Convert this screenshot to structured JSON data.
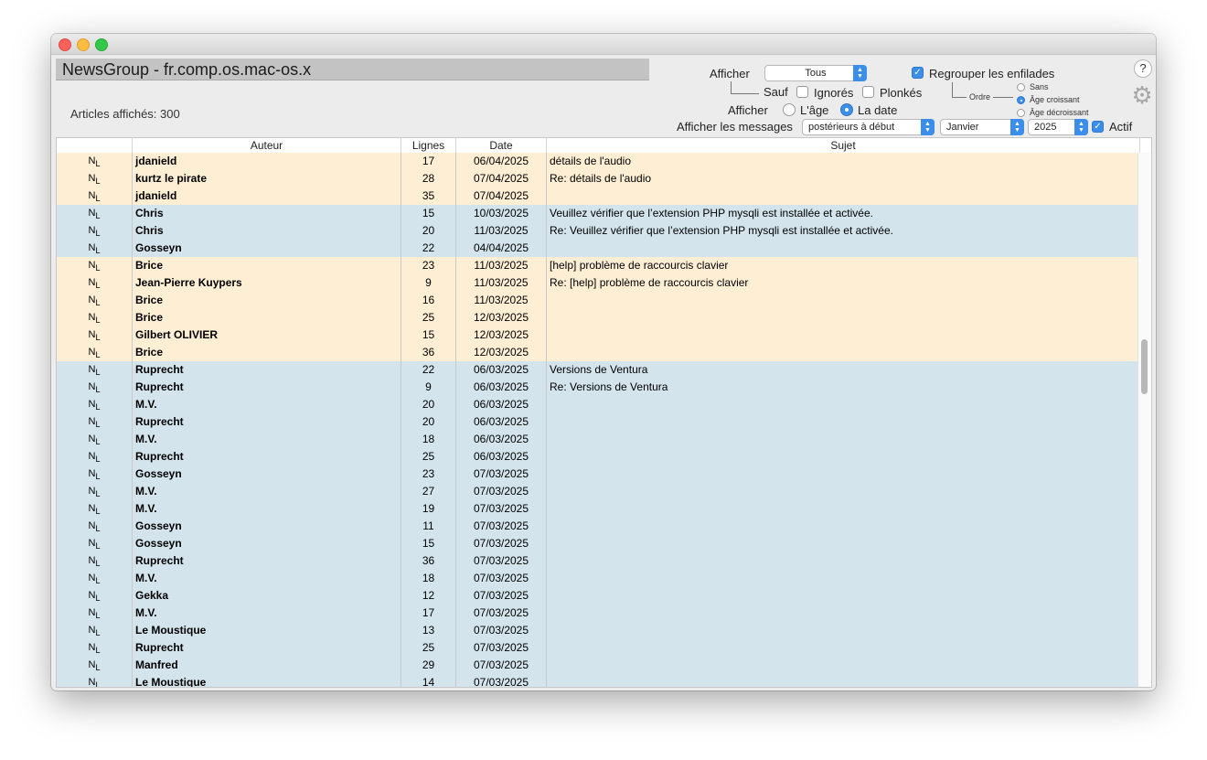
{
  "window": {
    "title": "NewsGroup - fr.comp.os.mac-os.x"
  },
  "status": {
    "articles_count": "Articles affichés: 300"
  },
  "filters": {
    "afficher_label": "Afficher",
    "show_select": "Tous",
    "sauf_label": "Sauf",
    "ignores_label": "Ignorés",
    "ignores_checked": false,
    "plonkes_label": "Plonkés",
    "plonkes_checked": false,
    "group_threads_label": "Regrouper les enfilades",
    "group_threads_checked": true,
    "ordre_label": "Ordre",
    "order_options": [
      "Sans",
      "Âge croissant",
      "Âge décroissant"
    ],
    "order_selected": "Âge croissant",
    "afficher2_label": "Afficher",
    "sort_age_label": "L'âge",
    "sort_date_label": "La date",
    "sort_selected": "La date",
    "show_messages_label": "Afficher les messages",
    "messages_select": "postérieurs à début",
    "month_select": "Janvier",
    "year_select": "2025",
    "actif_label": "Actif",
    "actif_checked": true
  },
  "icons": {
    "help": "?",
    "gear": "⚙",
    "row_marker": "N",
    "row_marker_sub": "L"
  },
  "table": {
    "columns": [
      "Auteur",
      "Lignes",
      "Date",
      "Sujet"
    ],
    "rows": [
      {
        "author": "jdanield",
        "lines": "17",
        "date": "06/04/2025",
        "subject": "détails de l'audio",
        "group": "orange"
      },
      {
        "author": "kurtz le pirate",
        "lines": "28",
        "date": "07/04/2025",
        "subject": "Re: détails de l'audio",
        "group": "orange"
      },
      {
        "author": "jdanield",
        "lines": "35",
        "date": "07/04/2025",
        "subject": "",
        "group": "orange"
      },
      {
        "author": "Chris",
        "lines": "15",
        "date": "10/03/2025",
        "subject": "Veuillez vérifier que l’extension PHP mysqli est installée et activée.",
        "group": "blue"
      },
      {
        "author": "Chris",
        "lines": "20",
        "date": "11/03/2025",
        "subject": "Re: Veuillez vérifier que l’extension PHP mysqli est installée et activée.",
        "group": "blue"
      },
      {
        "author": "Gosseyn",
        "lines": "22",
        "date": "04/04/2025",
        "subject": "",
        "group": "blue"
      },
      {
        "author": "Brice",
        "lines": "23",
        "date": "11/03/2025",
        "subject": "[help] problème de raccourcis clavier",
        "group": "orange"
      },
      {
        "author": "Jean-Pierre Kuypers",
        "lines": "9",
        "date": "11/03/2025",
        "subject": "Re: [help] problème de raccourcis clavier",
        "group": "orange"
      },
      {
        "author": "Brice",
        "lines": "16",
        "date": "11/03/2025",
        "subject": "",
        "group": "orange"
      },
      {
        "author": "Brice",
        "lines": "25",
        "date": "12/03/2025",
        "subject": "",
        "group": "orange"
      },
      {
        "author": "Gilbert OLIVIER",
        "lines": "15",
        "date": "12/03/2025",
        "subject": "",
        "group": "orange"
      },
      {
        "author": "Brice",
        "lines": "36",
        "date": "12/03/2025",
        "subject": "",
        "group": "orange"
      },
      {
        "author": "Ruprecht",
        "lines": "22",
        "date": "06/03/2025",
        "subject": "Versions de Ventura",
        "group": "blue"
      },
      {
        "author": "Ruprecht",
        "lines": "9",
        "date": "06/03/2025",
        "subject": "Re: Versions de Ventura",
        "group": "blue"
      },
      {
        "author": "M.V.",
        "lines": "20",
        "date": "06/03/2025",
        "subject": "",
        "group": "blue"
      },
      {
        "author": "Ruprecht",
        "lines": "20",
        "date": "06/03/2025",
        "subject": "",
        "group": "blue"
      },
      {
        "author": "M.V.",
        "lines": "18",
        "date": "06/03/2025",
        "subject": "",
        "group": "blue"
      },
      {
        "author": "Ruprecht",
        "lines": "25",
        "date": "06/03/2025",
        "subject": "",
        "group": "blue"
      },
      {
        "author": "Gosseyn",
        "lines": "23",
        "date": "07/03/2025",
        "subject": "",
        "group": "blue"
      },
      {
        "author": "M.V.",
        "lines": "27",
        "date": "07/03/2025",
        "subject": "",
        "group": "blue"
      },
      {
        "author": "M.V.",
        "lines": "19",
        "date": "07/03/2025",
        "subject": "",
        "group": "blue"
      },
      {
        "author": "Gosseyn",
        "lines": "11",
        "date": "07/03/2025",
        "subject": "",
        "group": "blue"
      },
      {
        "author": "Gosseyn",
        "lines": "15",
        "date": "07/03/2025",
        "subject": "",
        "group": "blue"
      },
      {
        "author": "Ruprecht",
        "lines": "36",
        "date": "07/03/2025",
        "subject": "",
        "group": "blue"
      },
      {
        "author": "M.V.",
        "lines": "18",
        "date": "07/03/2025",
        "subject": "",
        "group": "blue"
      },
      {
        "author": "Gekka",
        "lines": "12",
        "date": "07/03/2025",
        "subject": "",
        "group": "blue"
      },
      {
        "author": "M.V.",
        "lines": "17",
        "date": "07/03/2025",
        "subject": "",
        "group": "blue"
      },
      {
        "author": "Le Moustique",
        "lines": "13",
        "date": "07/03/2025",
        "subject": "",
        "group": "blue"
      },
      {
        "author": "Ruprecht",
        "lines": "25",
        "date": "07/03/2025",
        "subject": "",
        "group": "blue"
      },
      {
        "author": "Manfred",
        "lines": "29",
        "date": "07/03/2025",
        "subject": "",
        "group": "blue"
      },
      {
        "author": "Le Moustique",
        "lines": "14",
        "date": "07/03/2025",
        "subject": "",
        "group": "blue"
      }
    ]
  }
}
